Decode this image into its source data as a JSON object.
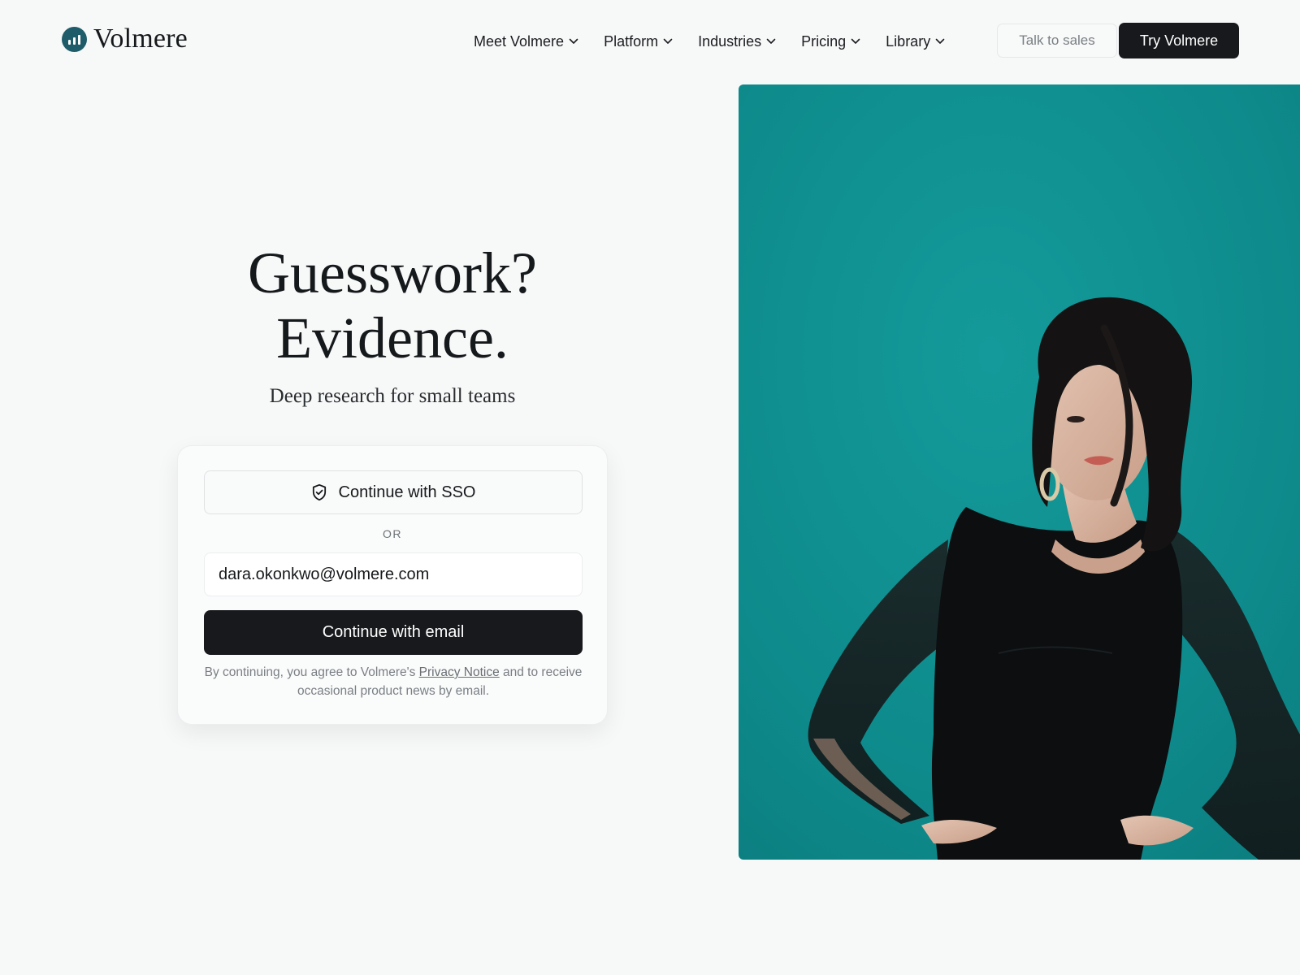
{
  "brand": {
    "name": "Volmere",
    "logo_icon": "bar-chart-circle-icon",
    "accent": "#1f5c6a"
  },
  "nav": {
    "items": [
      {
        "label": "Meet Volmere",
        "icon": "chevron-down-icon"
      },
      {
        "label": "Platform",
        "icon": "chevron-down-icon"
      },
      {
        "label": "Industries",
        "icon": "chevron-down-icon"
      },
      {
        "label": "Pricing",
        "icon": "chevron-down-icon"
      },
      {
        "label": "Library",
        "icon": "chevron-down-icon"
      }
    ],
    "talk_label": "Talk to sales",
    "try_label": "Try Volmere"
  },
  "hero": {
    "title_line1": "Guesswork?",
    "title_line2": "Evidence.",
    "subtitle": "Deep research for small teams"
  },
  "signin": {
    "sso_label": "Continue with SSO",
    "sso_icon": "shield-check-icon",
    "or_label": "OR",
    "email_value": "dara.okonkwo@volmere.com",
    "email_button_label": "Continue with email",
    "legal_before": "By continuing, you agree to Volmere's ",
    "legal_link": "Privacy Notice",
    "legal_after": " and to receive occasional product news by email."
  },
  "photo": {
    "background_color": "#0f8f8f",
    "subject_top_color": "#0c0e10"
  }
}
